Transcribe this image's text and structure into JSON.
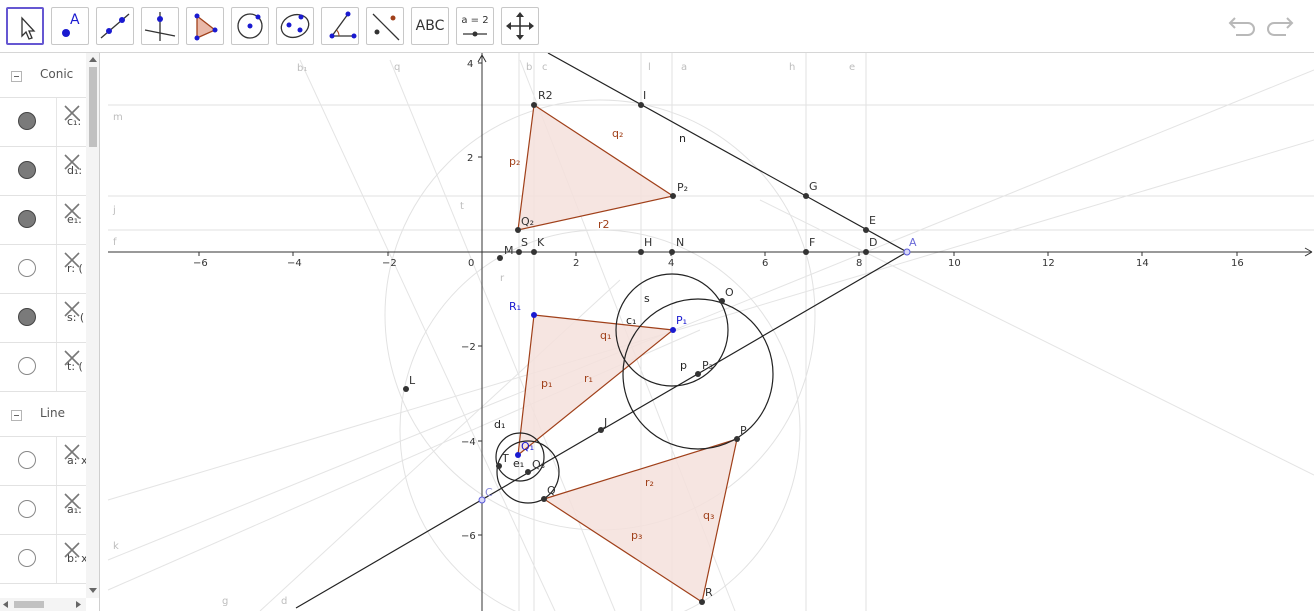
{
  "toolbar": {
    "tools": [
      {
        "name": "move-tool",
        "icon": "cursor-icon",
        "selected": true
      },
      {
        "name": "point-tool",
        "icon": "point-icon",
        "label": "A"
      },
      {
        "name": "line-tool",
        "icon": "line-icon"
      },
      {
        "name": "perpendicular-line-tool",
        "icon": "perpendicular-icon"
      },
      {
        "name": "polygon-tool",
        "icon": "polygon-icon"
      },
      {
        "name": "circle-center-point-tool",
        "icon": "circle-icon"
      },
      {
        "name": "ellipse-tool",
        "icon": "ellipse-icon"
      },
      {
        "name": "angle-tool",
        "icon": "angle-icon"
      },
      {
        "name": "reflect-tool",
        "icon": "reflect-icon"
      },
      {
        "name": "text-tool",
        "icon": "text-icon",
        "label": "ABC"
      },
      {
        "name": "slider-tool",
        "icon": "slider-icon",
        "label": "a = 2"
      },
      {
        "name": "move-graphics-tool",
        "icon": "move-arrows-icon"
      }
    ],
    "undo_icon": "undo-icon",
    "redo_icon": "redo-icon"
  },
  "algebra": {
    "groups": [
      {
        "label": "Conic",
        "rows": [
          {
            "text": "c₁:",
            "visible": true
          },
          {
            "text": "d₁:",
            "visible": true
          },
          {
            "text": "e₁:",
            "visible": true
          },
          {
            "text": "r: (",
            "visible": false
          },
          {
            "text": "s: (",
            "visible": true
          },
          {
            "text": "t: (",
            "visible": false
          }
        ]
      },
      {
        "label": "Line",
        "rows": [
          {
            "text": "a: x",
            "visible": false
          },
          {
            "text": "a₁:",
            "visible": false
          },
          {
            "text": "b: x",
            "visible": false
          }
        ]
      }
    ]
  },
  "axes": {
    "x_ticks": [
      "−6",
      "−4",
      "−2",
      "0",
      "2",
      "4",
      "6",
      "8",
      "10",
      "12",
      "14",
      "16"
    ],
    "y_ticks": [
      "4",
      "2",
      "−2",
      "−4",
      "−6"
    ]
  },
  "labels": {
    "points": [
      "R2",
      "I",
      "G",
      "E",
      "A",
      "D",
      "F",
      "N",
      "H",
      "K",
      "S",
      "M",
      "O",
      "P₁",
      "P₃",
      "R₁",
      "J",
      "L",
      "Q₁",
      "T",
      "Q₃",
      "C",
      "Q",
      "P",
      "R",
      "P₂",
      "Q₂"
    ],
    "objects": [
      "q₂",
      "n",
      "p₂",
      "r2",
      "s",
      "c₁",
      "q₁",
      "p",
      "p₁",
      "r₁",
      "d₁",
      "e₁",
      "r₂",
      "q₃",
      "p₃"
    ],
    "faint": [
      "b₁",
      "q",
      "b",
      "c",
      "l",
      "a",
      "h",
      "e",
      "m",
      "j",
      "f",
      "t",
      "k",
      "g",
      "d",
      "r"
    ]
  },
  "colors": {
    "triangle_fill": "#f4e1dc",
    "triangle_stroke": "#a0401a",
    "point_dark": "#333333",
    "point_free": "#1a1ad0",
    "guide_line": "#d9d9d9",
    "selected_tool": "#6557d2"
  }
}
